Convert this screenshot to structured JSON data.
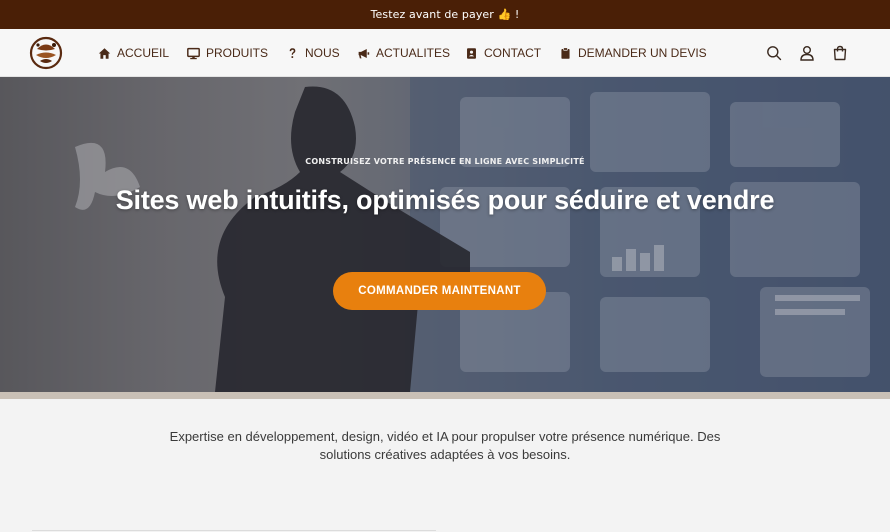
{
  "announcement": {
    "text": "Testez avant de payer 👍 !"
  },
  "nav": {
    "items": [
      {
        "label": "ACCUEIL",
        "icon": "home-icon"
      },
      {
        "label": "PRODUITS",
        "icon": "monitor-icon"
      },
      {
        "label": "NOUS",
        "icon": "question-icon"
      },
      {
        "label": "ACTUALITES",
        "icon": "megaphone-icon"
      },
      {
        "label": "CONTACT",
        "icon": "contact-card-icon"
      },
      {
        "label": "DEMANDER UN DEVIS",
        "icon": "clipboard-icon"
      }
    ]
  },
  "hero": {
    "subtitle": "Construisez votre présence en ligne avec simplicité",
    "title": "Sites web intuitifs, optimisés pour séduire et vendre",
    "cta_label": "COMMANDER MAINTENANT"
  },
  "intro": {
    "text": "Expertise en développement, design, vidéo et IA pour propulser votre présence numérique. Des solutions créatives adaptées à vos besoins."
  },
  "colors": {
    "announcement_bg": "#4a1f06",
    "nav_text": "#4a2a18",
    "cta_bg": "#e8800e"
  }
}
